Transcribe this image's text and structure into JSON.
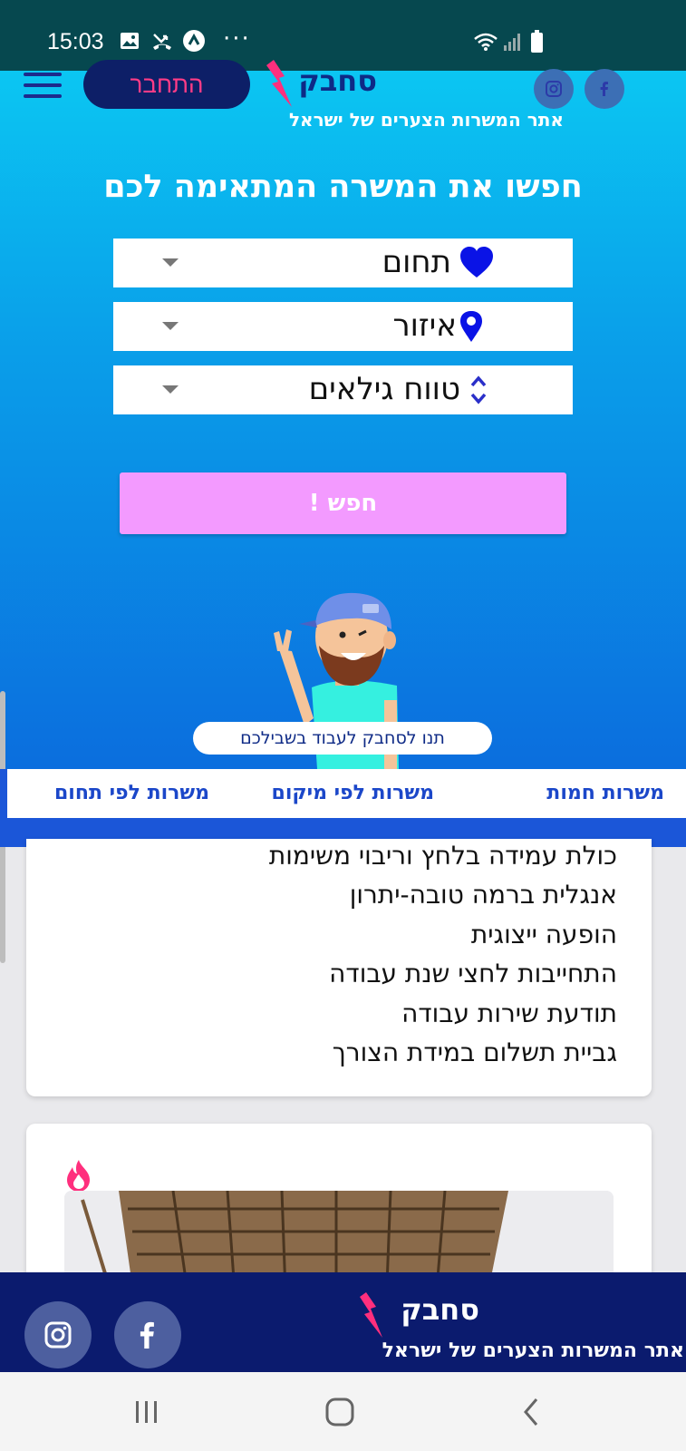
{
  "status_bar": {
    "time": "15:03",
    "icons": [
      "gallery-icon",
      "missed-call-icon",
      "app-notification-icon",
      "more-icon",
      "wifi-icon",
      "signal-icon",
      "battery-icon"
    ],
    "more": "···"
  },
  "header": {
    "login_label": "התחבר",
    "logo_name": "סחבק",
    "tagline": "אתר המשרות הצערים של ישראל",
    "social": [
      "instagram-icon",
      "facebook-icon"
    ]
  },
  "search": {
    "title": "חפשו את המשרה המתאימה לכם",
    "field_label": "תחום",
    "area_label": "איזור",
    "age_label": "טווח גילאים",
    "button_label": "חפש !"
  },
  "promo": {
    "pill_text": "תנו לסחבק לעבוד בשבילכם"
  },
  "tabs": [
    {
      "label": "משרות חמות"
    },
    {
      "label": "משרות לפי מיקום"
    },
    {
      "label": "משרות לפי תחום"
    }
  ],
  "requirements": [
    "כולת עמידה בלחץ וריבוי משימות",
    "אנגלית ברמה טובה-יתרון",
    "הופעה ייצוגית",
    " התחייבות לחצי שנת עבודה",
    "תודעת שירות עבודה",
    "גביית תשלום במידת הצורך"
  ],
  "footer": {
    "logo_name": "סחבק",
    "tagline": "אתר המשרות הצערים של ישראל"
  },
  "colors": {
    "brand_navy": "#0b1b6e",
    "accent_pink": "#ff2f7d",
    "search_button": "#f39aff",
    "tab_blue": "#1b56d8"
  }
}
